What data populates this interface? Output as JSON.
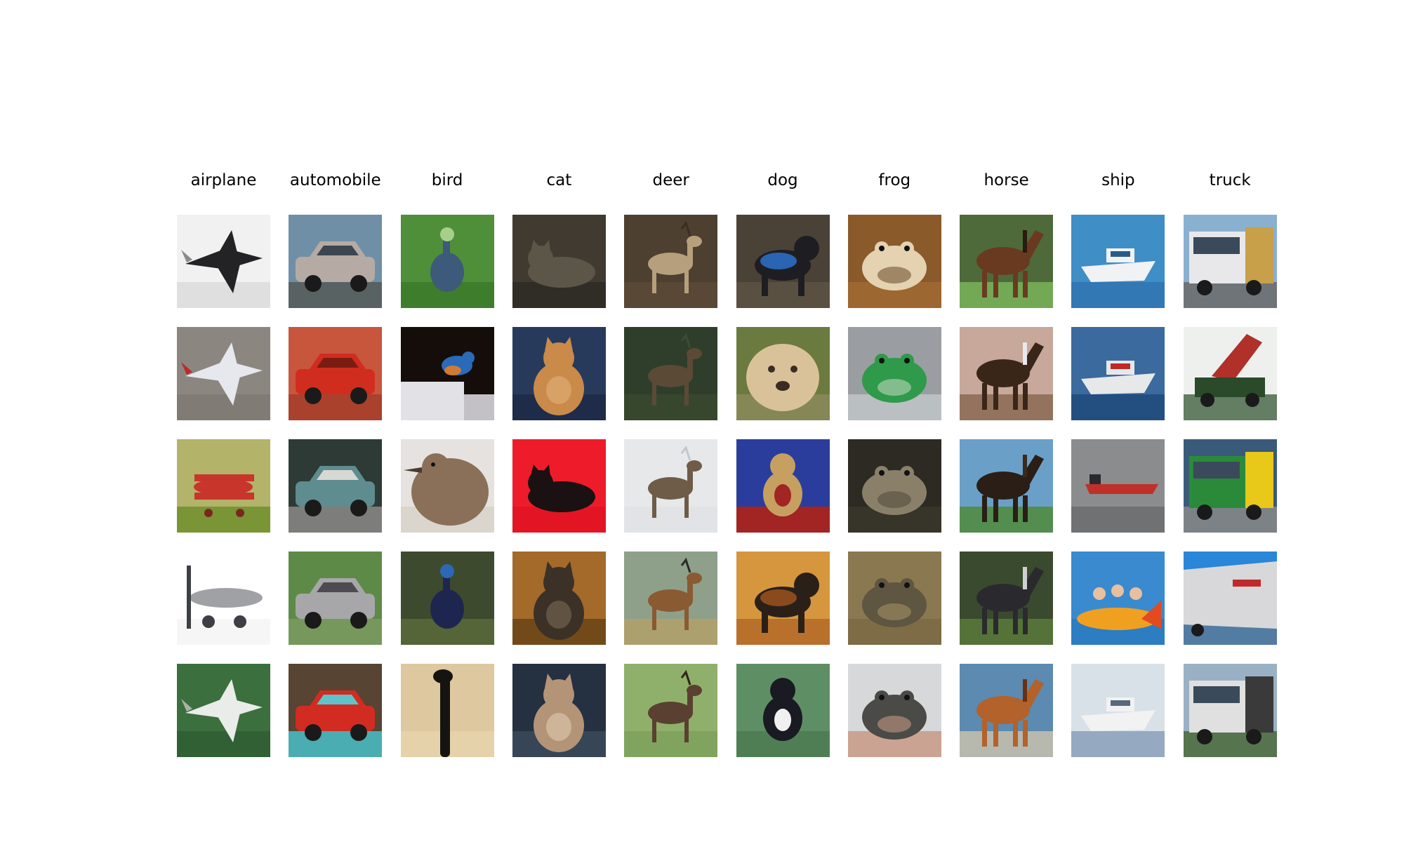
{
  "figure": {
    "classes": [
      {
        "label": "airplane",
        "samples": [
          {
            "subject": "dark stealth jet",
            "bg": "#f1f1f1",
            "fg": "#232326",
            "accent": "#8a8a8e",
            "ground": "#dcdcdc",
            "shape": "jet-dark"
          },
          {
            "subject": "white-red jet toy",
            "bg": "#8b8780",
            "fg": "#e6e8ee",
            "accent": "#c4262b",
            "ground": "#7e7a73",
            "shape": "jet"
          },
          {
            "subject": "red biplane",
            "bg": "#b3b36a",
            "fg": "#c8352a",
            "accent": "#7a2620",
            "ground": "#6f8f2d",
            "shape": "biplane"
          },
          {
            "subject": "grey propeller plane",
            "bg": "#ffffff",
            "fg": "#9fa1a5",
            "accent": "#3e3f44",
            "ground": "#f4f4f4",
            "shape": "prop"
          },
          {
            "subject": "white fighter jet",
            "bg": "#3b6f3d",
            "fg": "#e9ece8",
            "accent": "#a7b3a8",
            "ground": "#2f5e33",
            "shape": "jet"
          }
        ]
      },
      {
        "label": "automobile",
        "samples": [
          {
            "subject": "silver station wagon",
            "bg": "#6f8fa6",
            "fg": "#b5aba4",
            "accent": "#3d4650",
            "ground": "#555a57",
            "shape": "car"
          },
          {
            "subject": "red sports car",
            "bg": "#c7563c",
            "fg": "#d12d1f",
            "accent": "#7a1c12",
            "ground": "#a33d2a",
            "shape": "car-close"
          },
          {
            "subject": "teal vintage car",
            "bg": "#2e3a36",
            "fg": "#5f8c8e",
            "accent": "#d8d8d2",
            "ground": "#8b8a87",
            "shape": "car"
          },
          {
            "subject": "grey sedan",
            "bg": "#5e8a48",
            "fg": "#a7a7a9",
            "accent": "#4b4b50",
            "ground": "#7b9a60",
            "shape": "car-close"
          },
          {
            "subject": "red hatchback",
            "bg": "#574433",
            "fg": "#d22b22",
            "accent": "#5fc3c9",
            "ground": "#47bfc8",
            "shape": "car"
          }
        ]
      },
      {
        "label": "bird",
        "samples": [
          {
            "subject": "blue bird among leaves",
            "bg": "#4f8f3a",
            "fg": "#3d5a7a",
            "accent": "#a6d08a",
            "ground": "#3b7a2a",
            "shape": "bird-tall"
          },
          {
            "subject": "bluebird on post",
            "bg": "#140d0a",
            "fg": "#2a6ab8",
            "accent": "#d07a35",
            "ground": "#e2e2e6",
            "shape": "bird-perch"
          },
          {
            "subject": "brown sparrow close-up",
            "bg": "#e5e2df",
            "fg": "#8a7058",
            "accent": "#4a3b2e",
            "ground": "#d8d2ca",
            "shape": "bird-head"
          },
          {
            "subject": "cassowary in foliage",
            "bg": "#3d4a2e",
            "fg": "#1e2650",
            "accent": "#2d68b6",
            "ground": "#5a6a3a",
            "shape": "bird-tall"
          },
          {
            "subject": "ostrich neck",
            "bg": "#ddc8a0",
            "fg": "#161410",
            "accent": "#a08b6a",
            "ground": "#e6d3ad",
            "shape": "ostrich"
          }
        ]
      },
      {
        "label": "cat",
        "samples": [
          {
            "subject": "grey cat lying",
            "bg": "#413a30",
            "fg": "#5c5648",
            "accent": "#b39a7e",
            "ground": "#2e2a24",
            "shape": "cat-lying"
          },
          {
            "subject": "orange cat on blue chair",
            "bg": "#283a5c",
            "fg": "#c98a4a",
            "accent": "#e3b17a",
            "ground": "#1c2a45",
            "shape": "cat-sitting"
          },
          {
            "subject": "black cat on red",
            "bg": "#ee1c2a",
            "fg": "#1b1012",
            "accent": "#ff5b5e",
            "ground": "#e01423",
            "shape": "cat-lying"
          },
          {
            "subject": "fluffy grey cat",
            "bg": "#a36a2a",
            "fg": "#3b3127",
            "accent": "#7c6a55",
            "ground": "#6a4418",
            "shape": "cat-sitting"
          },
          {
            "subject": "tan cat in basket",
            "bg": "#253040",
            "fg": "#b39477",
            "accent": "#e0cbb1",
            "ground": "#3b4a5c",
            "shape": "cat-sitting"
          }
        ]
      },
      {
        "label": "deer",
        "samples": [
          {
            "subject": "deer in brush",
            "bg": "#4d4030",
            "fg": "#b69f7c",
            "accent": "#3a2e22",
            "ground": "#5b4a36",
            "shape": "deer"
          },
          {
            "subject": "deer in dark grass",
            "bg": "#2f3e2a",
            "fg": "#5a4a36",
            "accent": "#3c4c34",
            "ground": "#38492f",
            "shape": "deer"
          },
          {
            "subject": "deer on snow",
            "bg": "#e6e8ea",
            "fg": "#6e5c48",
            "accent": "#c3c8cd",
            "ground": "#dfe2e5",
            "shape": "deer"
          },
          {
            "subject": "moose pair",
            "bg": "#8ea08a",
            "fg": "#8a5a32",
            "accent": "#2b2a26",
            "ground": "#b3a06a",
            "shape": "deer"
          },
          {
            "subject": "elk on grass",
            "bg": "#8fb06a",
            "fg": "#5a4030",
            "accent": "#2f241c",
            "ground": "#7ea25a",
            "shape": "deer"
          }
        ]
      },
      {
        "label": "dog",
        "samples": [
          {
            "subject": "black dog in blue jacket",
            "bg": "#4a4236",
            "fg": "#1e1e22",
            "accent": "#2a64b2",
            "ground": "#5c5244",
            "shape": "dog"
          },
          {
            "subject": "fluffy dog",
            "bg": "#6b7a3e",
            "fg": "#d9c29a",
            "accent": "#3a2c22",
            "ground": "#8a8a5a",
            "shape": "dog-face"
          },
          {
            "subject": "tan dog on red rug",
            "bg": "#2b3d9c",
            "fg": "#c6a060",
            "accent": "#a22423",
            "ground": "#a22423",
            "shape": "dog-sitting"
          },
          {
            "subject": "black dog on wood floor",
            "bg": "#d6963e",
            "fg": "#2a2018",
            "accent": "#8a4a1e",
            "ground": "#b46a28",
            "shape": "dog"
          },
          {
            "subject": "black-white puppy on grass",
            "bg": "#5e8f64",
            "fg": "#1a1a22",
            "accent": "#f0f0f0",
            "ground": "#4f7e55",
            "shape": "dog-sitting"
          }
        ]
      },
      {
        "label": "frog",
        "samples": [
          {
            "subject": "pale frog on brown",
            "bg": "#8a5a2a",
            "fg": "#e4d2b0",
            "accent": "#5a3a1a",
            "ground": "#a06a33",
            "shape": "frog"
          },
          {
            "subject": "green frog statue",
            "bg": "#9a9ea2",
            "fg": "#2e9a4a",
            "accent": "#d8e0d0",
            "ground": "#c0c4c8",
            "shape": "frog"
          },
          {
            "subject": "mottled frog",
            "bg": "#2c2a22",
            "fg": "#8a806a",
            "accent": "#4a4434",
            "ground": "#3a362c",
            "shape": "frog"
          },
          {
            "subject": "toad on leaves",
            "bg": "#8a7850",
            "fg": "#5e5640",
            "accent": "#b09a6a",
            "ground": "#7a6a44",
            "shape": "frog"
          },
          {
            "subject": "toad in hand",
            "bg": "#d6d8da",
            "fg": "#4a4a46",
            "accent": "#d8a590",
            "ground": "#c89a86",
            "shape": "frog"
          }
        ]
      },
      {
        "label": "horse",
        "samples": [
          {
            "subject": "brown horse on grass",
            "bg": "#4e6a3a",
            "fg": "#6a3a20",
            "accent": "#2a1a10",
            "ground": "#7ab35a",
            "shape": "horse"
          },
          {
            "subject": "rider on horse",
            "bg": "#c7a89a",
            "fg": "#3a2618",
            "accent": "#e8e8ee",
            "ground": "#8a6a52",
            "shape": "horse"
          },
          {
            "subject": "dark horse on field",
            "bg": "#6aa0c8",
            "fg": "#2a1e16",
            "accent": "#3a2a1e",
            "ground": "#4f8a3a",
            "shape": "horse"
          },
          {
            "subject": "piebald horse",
            "bg": "#3a4a2e",
            "fg": "#2a2a2e",
            "accent": "#d0d0d4",
            "ground": "#5a7a3a",
            "shape": "horse"
          },
          {
            "subject": "chestnut horse",
            "bg": "#5c8ab0",
            "fg": "#b2622a",
            "accent": "#6a3014",
            "ground": "#c7c0ae",
            "shape": "horse"
          }
        ]
      },
      {
        "label": "ship",
        "samples": [
          {
            "subject": "speedboat on water",
            "bg": "#3f8ec6",
            "fg": "#f0f2f4",
            "accent": "#2a5a8a",
            "ground": "#2f74b0",
            "shape": "boat"
          },
          {
            "subject": "fishing boat",
            "bg": "#3a6a9e",
            "fg": "#e6e8ea",
            "accent": "#c0282a",
            "ground": "#1e4a7a",
            "shape": "boat"
          },
          {
            "subject": "tanker at sea",
            "bg": "#8a8c8e",
            "fg": "#c0302a",
            "accent": "#2a2a2e",
            "ground": "#6a6c6e",
            "shape": "tanker"
          },
          {
            "subject": "people on inflatable",
            "bg": "#3a8ad0",
            "fg": "#f0a020",
            "accent": "#e44a20",
            "ground": "#2a7ac0",
            "shape": "raft"
          },
          {
            "subject": "white yacht",
            "bg": "#d8e0e8",
            "fg": "#f2f2f2",
            "accent": "#5a6a7a",
            "ground": "#8aa0b8",
            "shape": "boat"
          }
        ]
      },
      {
        "label": "truck",
        "samples": [
          {
            "subject": "white semi truck",
            "bg": "#8ab0d0",
            "fg": "#e8e8ea",
            "accent": "#c8a04a",
            "ground": "#6a6a6a",
            "shape": "truck"
          },
          {
            "subject": "dump truck",
            "bg": "#eef0ee",
            "fg": "#b0302a",
            "accent": "#2a4a2a",
            "ground": "#4a6a4a",
            "shape": "dump"
          },
          {
            "subject": "green yellow truck",
            "bg": "#3a5a7a",
            "fg": "#2a8a3a",
            "accent": "#e8c818",
            "ground": "#8a8a8a",
            "shape": "truck"
          },
          {
            "subject": "white trailer",
            "bg": "#2a86d8",
            "fg": "#d8d8da",
            "accent": "#c02a2a",
            "ground": "#5a7a9a",
            "shape": "trailer"
          },
          {
            "subject": "truck by houses",
            "bg": "#9ab0c4",
            "fg": "#e0e0e0",
            "accent": "#3a3a3a",
            "ground": "#4a6a3a",
            "shape": "truck"
          }
        ]
      }
    ]
  }
}
